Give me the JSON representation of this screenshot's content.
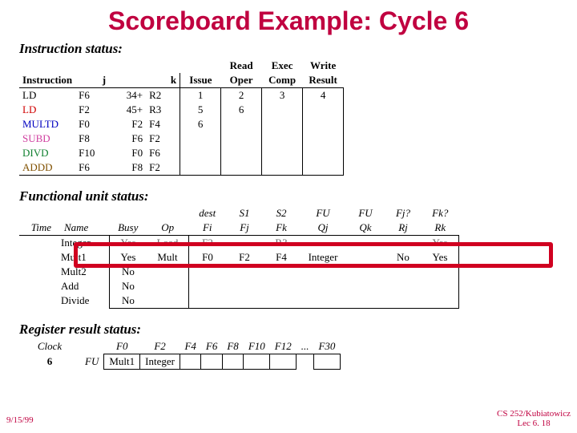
{
  "title": "Scoreboard Example: Cycle 6",
  "instr_status": {
    "heading": "Instruction status:",
    "top_headers": [
      "",
      "",
      "",
      "Read",
      "Exec",
      "Write"
    ],
    "headers": [
      "Instruction",
      "j",
      "k",
      "Issue",
      "Oper",
      "Comp",
      "Result"
    ],
    "rows": [
      {
        "name": "LD",
        "color": "",
        "j": "F6",
        "jn": "34+",
        "k": "R2",
        "issue": "1",
        "read": "2",
        "exec": "3",
        "write": "4"
      },
      {
        "name": "LD",
        "color": "c-red",
        "j": "F2",
        "jn": "45+",
        "k": "R3",
        "issue": "5",
        "read": "6",
        "exec": "",
        "write": ""
      },
      {
        "name": "MULTD",
        "color": "c-blue",
        "j": "F0",
        "jn": "",
        "k": "F2",
        "kreg": "F4",
        "issue": "6",
        "read": "",
        "exec": "",
        "write": ""
      },
      {
        "name": "SUBD",
        "color": "c-pink",
        "j": "F8",
        "jn": "",
        "k": "F6",
        "kreg": "F2",
        "issue": "",
        "read": "",
        "exec": "",
        "write": ""
      },
      {
        "name": "DIVD",
        "color": "c-green",
        "j": "F10",
        "jn": "",
        "k": "F0",
        "kreg": "F6",
        "issue": "",
        "read": "",
        "exec": "",
        "write": ""
      },
      {
        "name": "ADDD",
        "color": "c-brown",
        "j": "F6",
        "jn": "",
        "k": "F8",
        "kreg": "F2",
        "issue": "",
        "read": "",
        "exec": "",
        "write": ""
      }
    ]
  },
  "fu_status": {
    "heading": "Functional unit status:",
    "top_headers": [
      "",
      "",
      "",
      "",
      "dest",
      "S1",
      "S2",
      "FU",
      "FU",
      "Fj?",
      "Fk?"
    ],
    "headers": [
      "Time",
      "Name",
      "Busy",
      "Op",
      "Fi",
      "Fj",
      "Fk",
      "Qj",
      "Qk",
      "Rj",
      "Rk"
    ],
    "rows": [
      {
        "time": "",
        "name": "Integer",
        "busy": "Yes",
        "busy_strike": true,
        "op": "Load",
        "op_strike": true,
        "fi": "F2",
        "fi_strike": true,
        "fj": "",
        "fk": "R3",
        "fk_strike": true,
        "qj": "",
        "qk": "",
        "rj": "",
        "rk": "Yes",
        "rk_strike": true
      },
      {
        "time": "",
        "name": "Mult1",
        "busy": "Yes",
        "op": "Mult",
        "fi": "F0",
        "fj": "F2",
        "fk": "F4",
        "qj": "Integer",
        "qk": "",
        "rj": "No",
        "rk": "Yes"
      },
      {
        "time": "",
        "name": "Mult2",
        "busy": "No",
        "op": "",
        "fi": "",
        "fj": "",
        "fk": "",
        "qj": "",
        "qk": "",
        "rj": "",
        "rk": ""
      },
      {
        "time": "",
        "name": "Add",
        "busy": "No",
        "op": "",
        "fi": "",
        "fj": "",
        "fk": "",
        "qj": "",
        "qk": "",
        "rj": "",
        "rk": ""
      },
      {
        "time": "",
        "name": "Divide",
        "busy": "No",
        "op": "",
        "fi": "",
        "fj": "",
        "fk": "",
        "qj": "",
        "qk": "",
        "rj": "",
        "rk": ""
      }
    ]
  },
  "reg_status": {
    "heading": "Register result status:",
    "clock_label": "Clock",
    "clock_value": "6",
    "fu_label": "FU",
    "headers": [
      "F0",
      "F2",
      "F4",
      "F6",
      "F8",
      "F10",
      "F12",
      "...",
      "F30"
    ],
    "values": [
      "Mult1",
      "Integer",
      "",
      "",
      "",
      "",
      "",
      "",
      ""
    ]
  },
  "footer": {
    "date": "9/15/99",
    "course": "CS 252/Kubiatowicz",
    "lec": "Lec 6. 18"
  }
}
